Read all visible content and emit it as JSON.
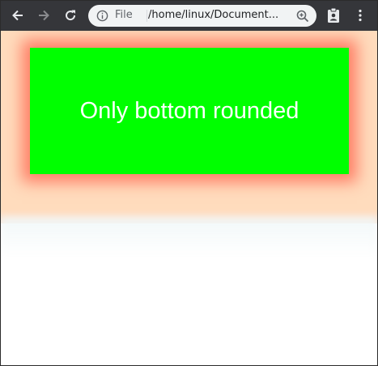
{
  "browser": {
    "origin_chip": "File",
    "url": "/home/linux/Document...",
    "icons": {
      "back": "arrow-left-icon",
      "forward": "arrow-right-icon",
      "reload": "reload-icon",
      "info": "info-icon",
      "zoom": "zoom-in-icon",
      "extension": "clipboard-person-icon",
      "menu": "kebab-menu-icon"
    }
  },
  "page": {
    "box_text": "Only bottom rounded",
    "colors": {
      "box_background": "#00ff00",
      "box_shadow": "#ff7f66",
      "page_background": "#ffdcbd",
      "text": "#ffffff"
    }
  }
}
